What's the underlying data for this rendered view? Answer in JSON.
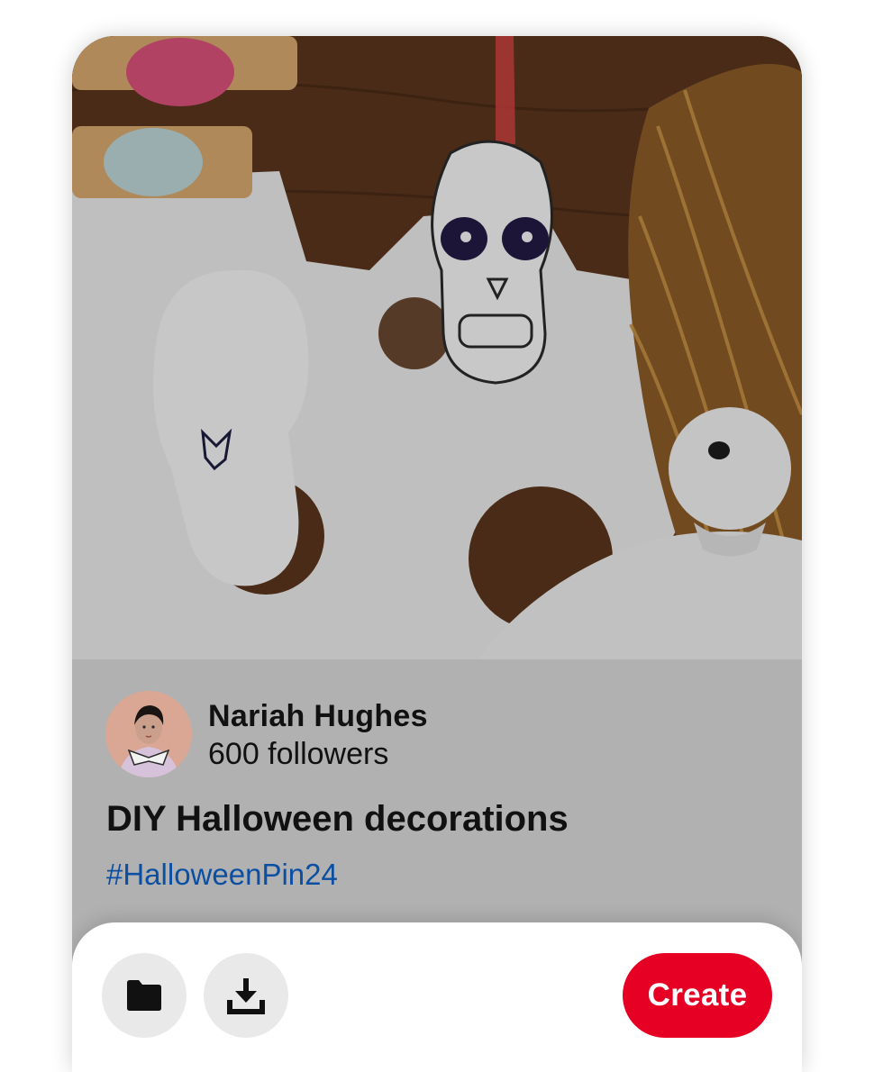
{
  "pin": {
    "image_alt": "Halloween felt crafts",
    "creator": {
      "name": "Nariah Hughes",
      "followers": "600 followers"
    },
    "title": "DIY Halloween decorations",
    "hashtag": "#HalloweenPin24"
  },
  "actions": {
    "save_icon": "folder-icon",
    "download_icon": "download-icon",
    "create_label": "Create"
  },
  "colors": {
    "create_button": "#e60023",
    "hashtag": "#0b4fa3",
    "info_background": "#b1b1b1"
  }
}
